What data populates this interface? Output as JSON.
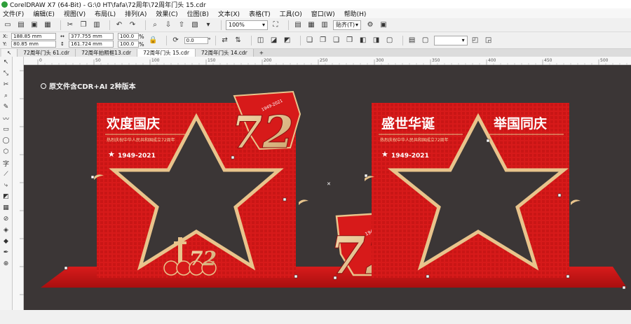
{
  "window": {
    "title": "CorelDRAW X7 (64-Bit) - G:\\0 HT\\fafa\\72周年\\72周年门头 15.cdr"
  },
  "menu": [
    "文件(F)",
    "编辑(E)",
    "视图(V)",
    "布局(L)",
    "排列(A)",
    "效果(C)",
    "位图(B)",
    "文本(X)",
    "表格(T)",
    "工具(O)",
    "窗口(W)",
    "帮助(H)"
  ],
  "toolbar": {
    "zoom": "100%",
    "snap": "贴齐(T)"
  },
  "properties": {
    "x": "188.85 mm",
    "y": "80.85 mm",
    "w": "377.755 mm",
    "h": "161.724 mm",
    "scale_x": "100.0",
    "scale_y": "100.0",
    "pct": "%",
    "angle": "0.0",
    "angle_unit": "°"
  },
  "tabs": [
    "72周年门头 61.cdr",
    "72周年拍照框13.cdr",
    "72周年门头 15.cdr",
    "72周年门头 14.cdr"
  ],
  "active_tab": 2,
  "ruler_labels": [
    "0",
    "50",
    "100",
    "150",
    "200",
    "250",
    "300",
    "350",
    "400",
    "450",
    "500"
  ],
  "canvas": {
    "note": "原文件含CDR+AI 2种版本",
    "left_board": {
      "headline": "欢度国庆",
      "subline": "热烈庆祝中华人民共和国成立72周年",
      "years": "1949-2021",
      "number": "72",
      "small_number": "72",
      "years_badge": "1949-2021"
    },
    "right_board": {
      "headline_left": "盛世华诞",
      "headline_right": "举国同庆",
      "subline": "热烈庆祝中华人民共和国成立72周年",
      "years": "1949-2021"
    },
    "center_piece": {
      "number": "72",
      "years_badge": "1949-2021"
    }
  },
  "colors": {
    "red": "#d71a1a",
    "gold": "#e8c48c",
    "dark_bg": "#3b3636",
    "floor": "#c41414"
  }
}
